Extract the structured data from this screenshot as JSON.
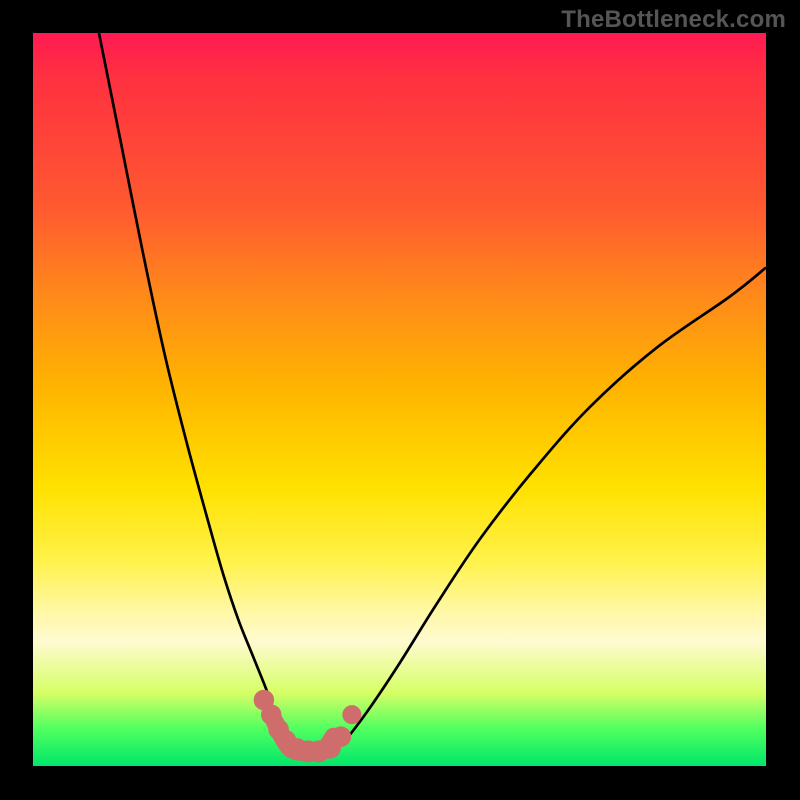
{
  "watermark": "TheBottleneck.com",
  "chart_data": {
    "type": "line",
    "title": "",
    "xlabel": "",
    "ylabel": "",
    "xlim": [
      0,
      100
    ],
    "ylim": [
      0,
      100
    ],
    "gradient_stops": [
      {
        "pct": 0,
        "color": "#ff1a53"
      },
      {
        "pct": 6,
        "color": "#ff3040"
      },
      {
        "pct": 24,
        "color": "#ff5a30"
      },
      {
        "pct": 36,
        "color": "#ff8a1a"
      },
      {
        "pct": 48,
        "color": "#ffb300"
      },
      {
        "pct": 62,
        "color": "#ffe100"
      },
      {
        "pct": 72,
        "color": "#fff24a"
      },
      {
        "pct": 78,
        "color": "#fff79a"
      },
      {
        "pct": 83,
        "color": "#fffad0"
      },
      {
        "pct": 90,
        "color": "#d6ff66"
      },
      {
        "pct": 95,
        "color": "#4fff60"
      },
      {
        "pct": 100,
        "color": "#00e66a"
      }
    ],
    "series": [
      {
        "name": "left-curve",
        "x": [
          9,
          12,
          15,
          18,
          21,
          24,
          26,
          28,
          30,
          32,
          33,
          34,
          35,
          36,
          37
        ],
        "y": [
          100,
          85,
          70,
          56,
          44,
          33,
          26,
          20,
          15,
          10,
          7,
          5,
          3.5,
          2.5,
          2
        ]
      },
      {
        "name": "right-curve",
        "x": [
          41,
          43,
          46,
          50,
          55,
          61,
          68,
          76,
          85,
          95,
          100
        ],
        "y": [
          2,
          4,
          8,
          14,
          22,
          31,
          40,
          49,
          57,
          64,
          68
        ]
      },
      {
        "name": "valley-floor",
        "x": [
          33,
          34,
          35,
          36,
          37,
          38,
          39,
          40,
          41
        ],
        "y": [
          6,
          4,
          2.5,
          2,
          2,
          2,
          2,
          2.5,
          4
        ]
      }
    ],
    "markers": [
      {
        "x": 31.5,
        "y": 9,
        "r": 1.4
      },
      {
        "x": 32.5,
        "y": 7,
        "r": 1.4
      },
      {
        "x": 33.5,
        "y": 5,
        "r": 1.4
      },
      {
        "x": 34.5,
        "y": 3.5,
        "r": 1.4
      },
      {
        "x": 36,
        "y": 2.3,
        "r": 1.5
      },
      {
        "x": 37.5,
        "y": 2,
        "r": 1.5
      },
      {
        "x": 39,
        "y": 2,
        "r": 1.5
      },
      {
        "x": 40.5,
        "y": 2.5,
        "r": 1.5
      },
      {
        "x": 42,
        "y": 4,
        "r": 1.4
      },
      {
        "x": 43.5,
        "y": 7,
        "r": 1.3
      }
    ],
    "marker_color": "#cf6d6d",
    "curve_color": "#000000",
    "curve_width": 2.7,
    "valley_width": 18
  }
}
